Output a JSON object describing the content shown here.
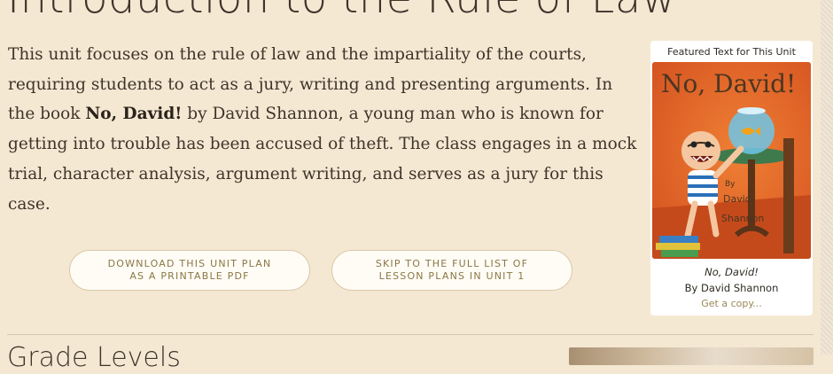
{
  "page": {
    "title": "Introduction to the Rule of Law",
    "intro_before_book": "This unit focuses on the rule of law and the impartiality of the courts, requiring students to act as a jury, writing and presenting arguments. In the book ",
    "intro_book": "No, David!",
    "intro_after_book": " by David Shannon, a young man who is known for getting into trouble has been accused of theft. The class engages in a mock trial, character analysis, argument writing, and serves as a jury for this case."
  },
  "actions": {
    "download_line1": "DOWNLOAD THIS UNIT PLAN",
    "download_line2": "AS A PRINTABLE PDF",
    "skip_line1": "SKIP TO THE FULL LIST OF",
    "skip_line2": "LESSON PLANS IN UNIT 1"
  },
  "featured": {
    "heading": "Featured Text for This Unit",
    "cover_title": "No, David!",
    "cover_by": "By",
    "cover_author_first": "David",
    "cover_author_last": "Shannon",
    "book_title": "No, David!",
    "book_author": "By David Shannon",
    "link": "Get a copy..."
  },
  "next_section": {
    "title": "Grade Levels"
  },
  "colors": {
    "background": "#f4e8d3",
    "button_text": "#8b7744",
    "link": "#9a8755",
    "cover_orange": "#e8662c"
  },
  "icons": [
    "book-cover-illustration"
  ]
}
